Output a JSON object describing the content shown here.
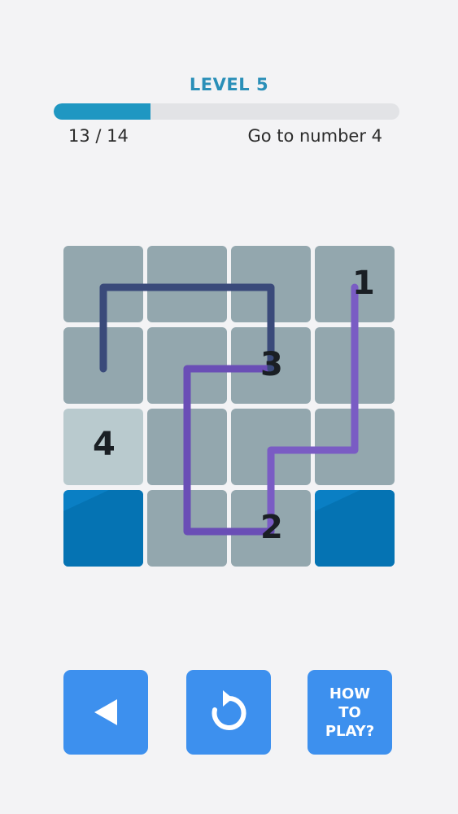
{
  "header": {
    "level_title": "LEVEL 5",
    "progress_fraction": 0.28,
    "progress_count": "13 / 14",
    "goal_text": "Go to number 4"
  },
  "board": {
    "rows": 4,
    "cols": 4,
    "cells": [
      {
        "row": 0,
        "col": 0,
        "state": "normal",
        "number": ""
      },
      {
        "row": 0,
        "col": 1,
        "state": "normal",
        "number": ""
      },
      {
        "row": 0,
        "col": 2,
        "state": "normal",
        "number": ""
      },
      {
        "row": 0,
        "col": 3,
        "state": "normal",
        "number": "1"
      },
      {
        "row": 1,
        "col": 0,
        "state": "normal",
        "number": ""
      },
      {
        "row": 1,
        "col": 1,
        "state": "normal",
        "number": ""
      },
      {
        "row": 1,
        "col": 2,
        "state": "normal",
        "number": "3"
      },
      {
        "row": 1,
        "col": 3,
        "state": "normal",
        "number": ""
      },
      {
        "row": 2,
        "col": 0,
        "state": "light",
        "number": "4"
      },
      {
        "row": 2,
        "col": 1,
        "state": "normal",
        "number": ""
      },
      {
        "row": 2,
        "col": 2,
        "state": "normal",
        "number": ""
      },
      {
        "row": 2,
        "col": 3,
        "state": "normal",
        "number": ""
      },
      {
        "row": 3,
        "col": 0,
        "state": "blocked",
        "number": ""
      },
      {
        "row": 3,
        "col": 1,
        "state": "normal",
        "number": ""
      },
      {
        "row": 3,
        "col": 2,
        "state": "normal",
        "number": "2"
      },
      {
        "row": 3,
        "col": 3,
        "state": "blocked",
        "number": ""
      }
    ],
    "path_segments": [
      {
        "name": "path-1-to-2",
        "color": "#7a5cc4",
        "cells": [
          [
            0,
            3
          ],
          [
            1,
            3
          ],
          [
            2,
            3
          ],
          [
            2,
            2
          ],
          [
            3,
            2
          ]
        ]
      },
      {
        "name": "path-2-to-3",
        "color": "#6a4eb6",
        "cells": [
          [
            3,
            2
          ],
          [
            3,
            1
          ],
          [
            2,
            1
          ],
          [
            1,
            1
          ],
          [
            1,
            2
          ]
        ]
      },
      {
        "name": "path-3-to-4",
        "color": "#3a4a7a",
        "cells": [
          [
            1,
            2
          ],
          [
            0,
            2
          ],
          [
            0,
            1
          ],
          [
            0,
            0
          ],
          [
            1,
            0
          ]
        ]
      }
    ]
  },
  "controls": {
    "back_icon": "triangle-left-icon",
    "restart_icon": "restart-arrow-icon",
    "help_lines": [
      "HOW",
      "TO",
      "PLAY?"
    ]
  },
  "colors": {
    "accent": "#2a8fb8",
    "progress_fill": "#1f97c2",
    "button": "#3d90ee",
    "tile": "#93a7ae",
    "tile_light": "#b9cace",
    "tile_blocked": "#0a7fc4"
  }
}
